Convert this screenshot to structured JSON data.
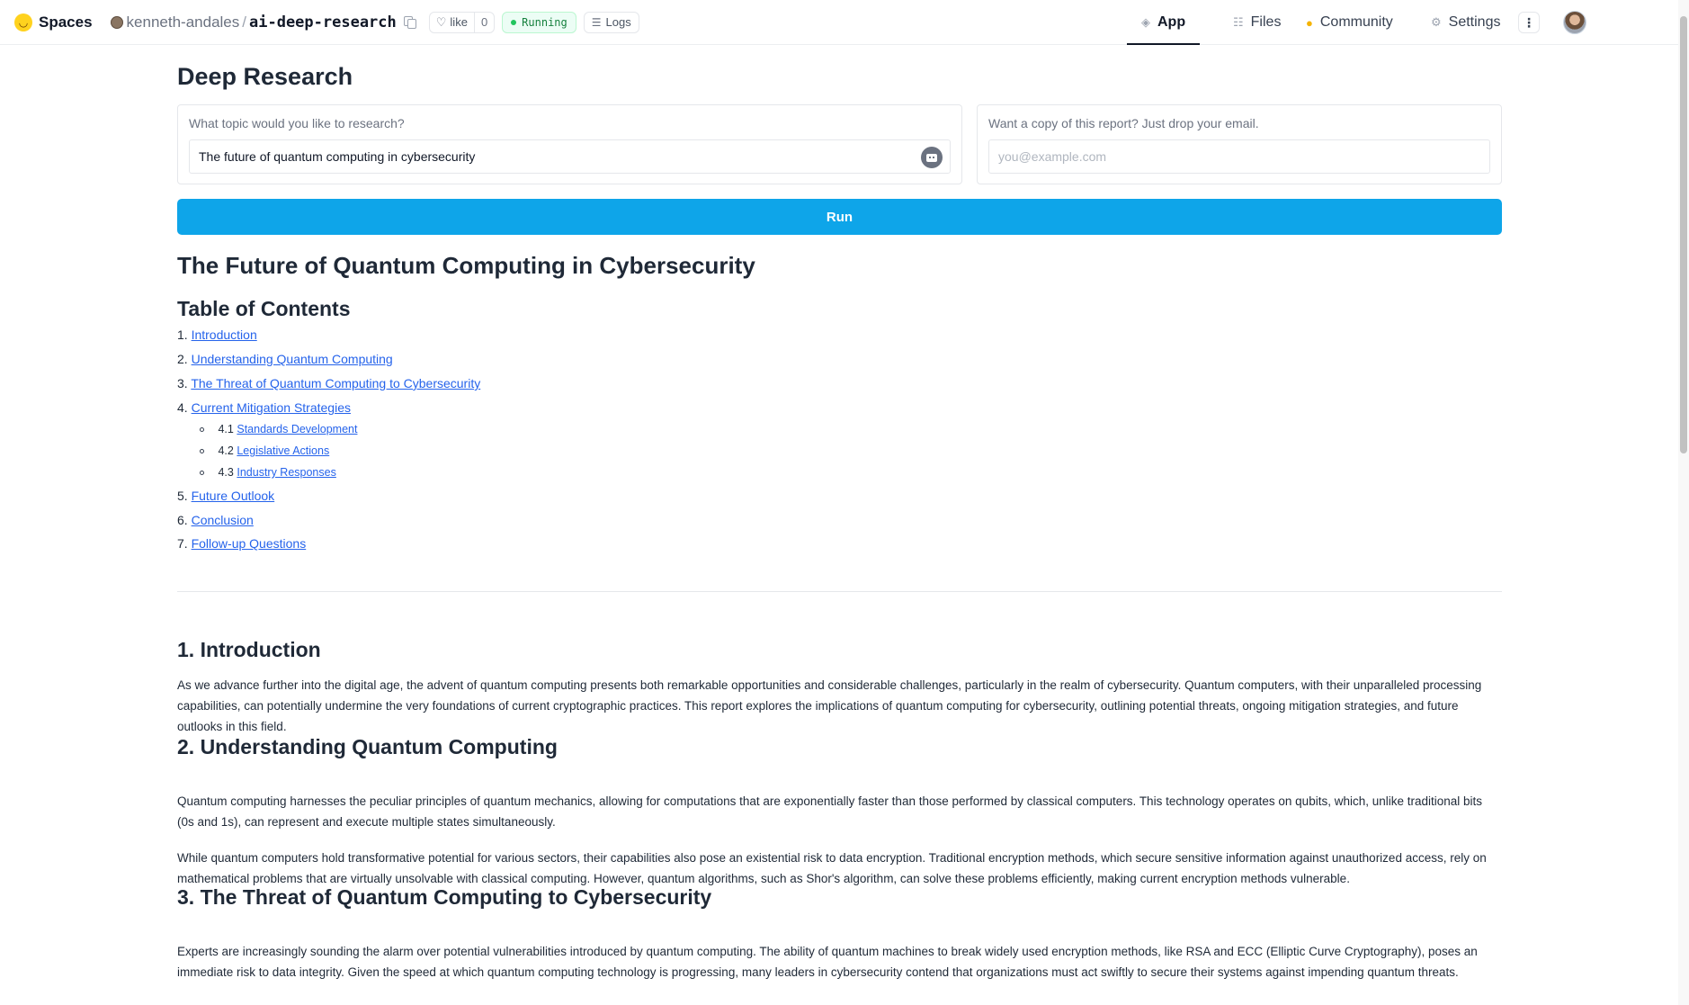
{
  "topbar": {
    "brand": "Spaces",
    "owner": "kenneth-andales",
    "separator": "/",
    "repo": "ai-deep-research",
    "like_label": "like",
    "like_count": "0",
    "status": "Running",
    "logs_label": "Logs",
    "tabs": [
      {
        "label": "App",
        "icon": "cube-icon",
        "active": true
      },
      {
        "label": "Files",
        "icon": "files-icon",
        "active": false
      },
      {
        "label": "Community",
        "icon": "community-icon",
        "active": false
      },
      {
        "label": "Settings",
        "icon": "gear-icon",
        "active": false
      }
    ],
    "more_label": "⋮"
  },
  "app": {
    "title": "Deep Research",
    "topic_label": "What topic would you like to research?",
    "topic_value": "The future of quantum computing in cybersecurity",
    "email_label": "Want a copy of this report? Just drop your email.",
    "email_placeholder": "you@example.com",
    "run_label": "Run"
  },
  "report": {
    "title": "The Future of Quantum Computing in Cybersecurity",
    "toc_heading": "Table of Contents",
    "toc": [
      {
        "num": "1.",
        "label": "Introduction"
      },
      {
        "num": "2.",
        "label": "Understanding Quantum Computing"
      },
      {
        "num": "3.",
        "label": "The Threat of Quantum Computing to Cybersecurity"
      },
      {
        "num": "4.",
        "label": "Current Mitigation Strategies"
      },
      {
        "num": "5.",
        "label": "Future Outlook"
      },
      {
        "num": "6.",
        "label": "Conclusion"
      },
      {
        "num": "7.",
        "label": "Follow-up Questions"
      }
    ],
    "toc_sub": [
      {
        "num": "4.1",
        "label": "Standards Development"
      },
      {
        "num": "4.2",
        "label": "Legislative Actions"
      },
      {
        "num": "4.3",
        "label": "Industry Responses"
      }
    ],
    "sections": [
      {
        "heading": "1. Introduction",
        "paragraphs": [
          "As we advance further into the digital age, the advent of quantum computing presents both remarkable opportunities and considerable challenges, particularly in the realm of cybersecurity. Quantum computers, with their unparalleled processing capabilities, can potentially undermine the very foundations of current cryptographic practices. This report explores the implications of quantum computing for cybersecurity, outlining potential threats, ongoing mitigation strategies, and future outlooks in this field."
        ]
      },
      {
        "heading": "2. Understanding Quantum Computing",
        "paragraphs": [
          "Quantum computing harnesses the peculiar principles of quantum mechanics, allowing for computations that are exponentially faster than those performed by classical computers. This technology operates on qubits, which, unlike traditional bits (0s and 1s), can represent and execute multiple states simultaneously.",
          "While quantum computers hold transformative potential for various sectors, their capabilities also pose an existential risk to data encryption. Traditional encryption methods, which secure sensitive information against unauthorized access, rely on mathematical problems that are virtually unsolvable with classical computing. However, quantum algorithms, such as Shor's algorithm, can solve these problems efficiently, making current encryption methods vulnerable."
        ]
      },
      {
        "heading": "3. The Threat of Quantum Computing to Cybersecurity",
        "paragraphs": [
          "Experts are increasingly sounding the alarm over potential vulnerabilities introduced by quantum computing. The ability of quantum machines to break widely used encryption methods, like RSA and ECC (Elliptic Curve Cryptography), poses an immediate risk to data integrity. Given the speed at which quantum computing technology is progressing, many leaders in cybersecurity contend that organizations must act swiftly to secure their systems against impending quantum threats."
        ]
      }
    ]
  }
}
